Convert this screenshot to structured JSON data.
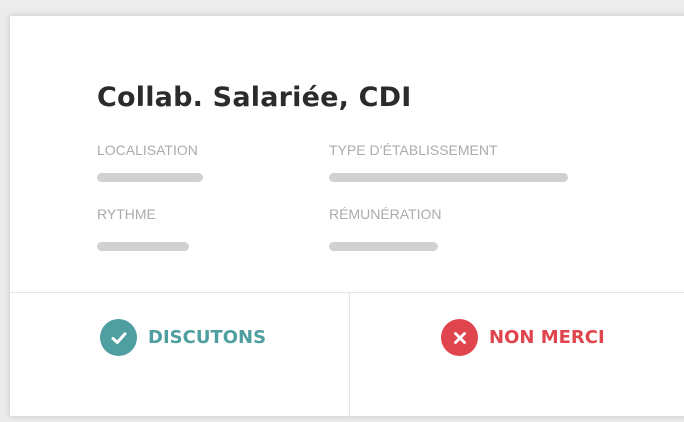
{
  "card": {
    "title": "Collab. Salariée, CDI",
    "fields": {
      "location_label": "LOCALISATION",
      "establishment_type_label": "TYPE D’ÉTABLISSEMENT",
      "rhythm_label": "RYTHME",
      "salary_label": "RÉMUNÉRATION"
    }
  },
  "actions": {
    "accept": {
      "label": "DISCUTONS",
      "icon": "check-circle-icon",
      "color": "#4f9ea0"
    },
    "decline": {
      "label": "NON MERCI",
      "icon": "close-circle-icon",
      "color": "#e0454d"
    }
  },
  "colors": {
    "placeholder_bar": "#cfd1d3",
    "label_text": "#a9acae",
    "title_text": "#2b2b2b"
  }
}
